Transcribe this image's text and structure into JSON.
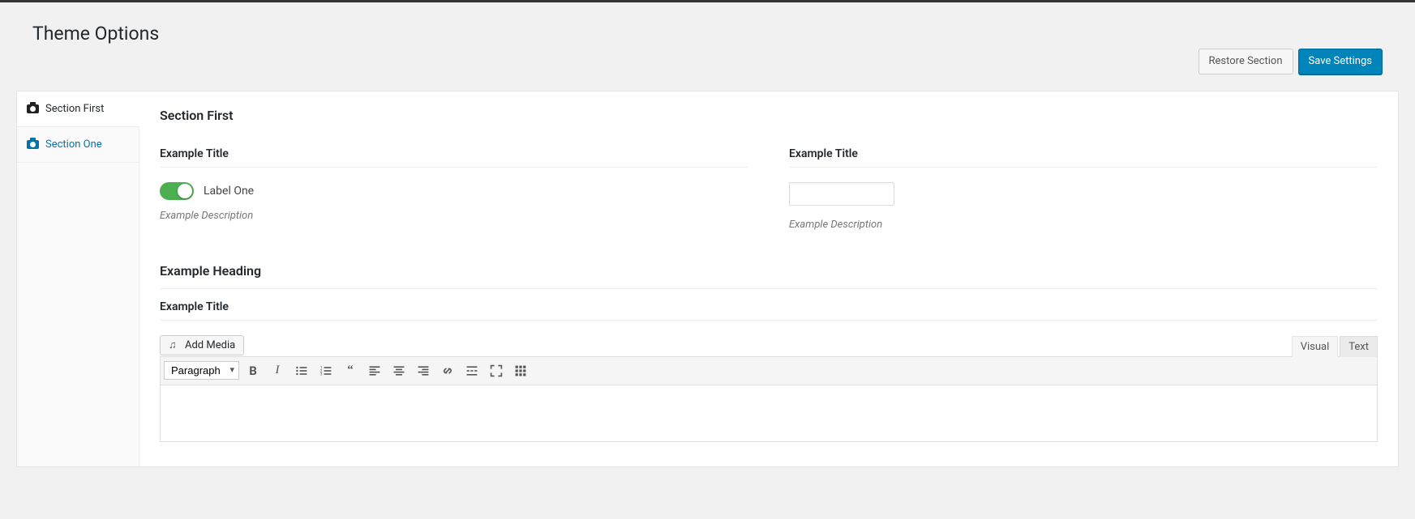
{
  "page_title": "Theme Options",
  "actions": {
    "restore": "Restore Section",
    "save": "Save Settings"
  },
  "sidebar": {
    "items": [
      {
        "label": "Section First",
        "active": true
      },
      {
        "label": "Section One",
        "active": false
      }
    ]
  },
  "content": {
    "section_title": "Section First",
    "field1": {
      "title": "Example Title",
      "toggle_on": true,
      "toggle_label": "Label One",
      "description": "Example Description"
    },
    "field2": {
      "title": "Example Title",
      "value": "",
      "description": "Example Description"
    },
    "heading": "Example Heading",
    "field3": {
      "title": "Example Title"
    },
    "editor": {
      "add_media": "Add Media",
      "tabs": {
        "visual": "Visual",
        "text": "Text",
        "active": "visual"
      },
      "format": "Paragraph"
    }
  }
}
